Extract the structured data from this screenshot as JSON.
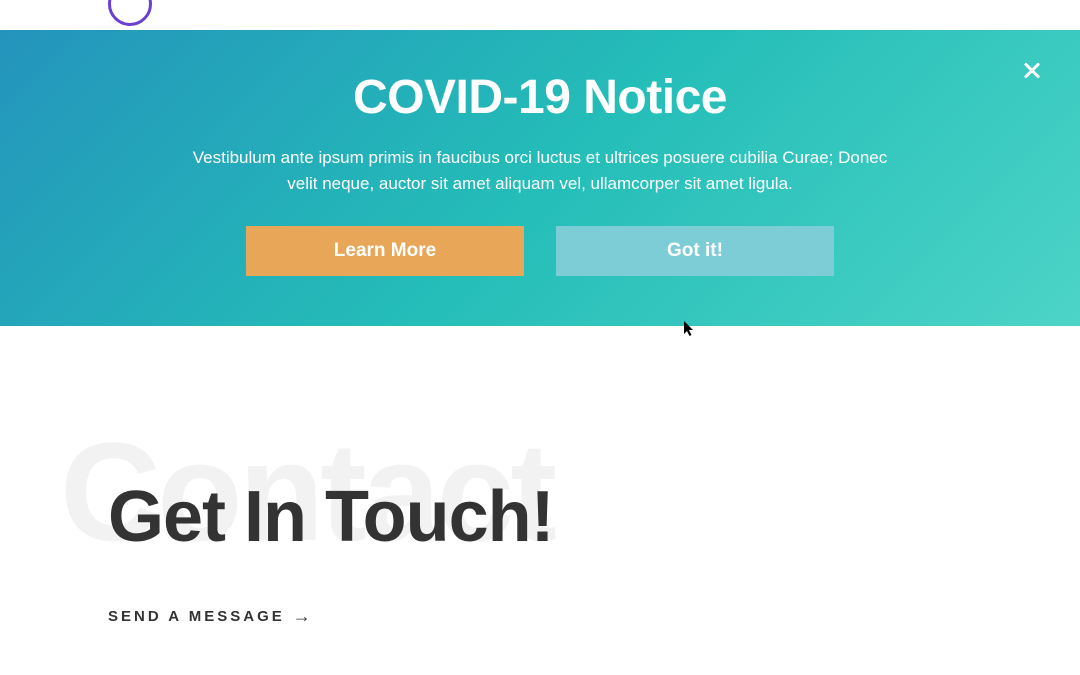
{
  "notice": {
    "title": "COVID-19 Notice",
    "text": "Vestibulum ante ipsum primis in faucibus orci luctus et ultrices posuere cubilia Curae; Donec velit neque, auctor sit amet aliquam vel, ullamcorper sit amet ligula.",
    "learn_more_label": "Learn More",
    "got_it_label": "Got it!"
  },
  "main": {
    "bg_text": "Contact",
    "heading": "Get In Touch!",
    "cta_label": "SEND A MESSAGE",
    "cta_arrow": "→"
  }
}
